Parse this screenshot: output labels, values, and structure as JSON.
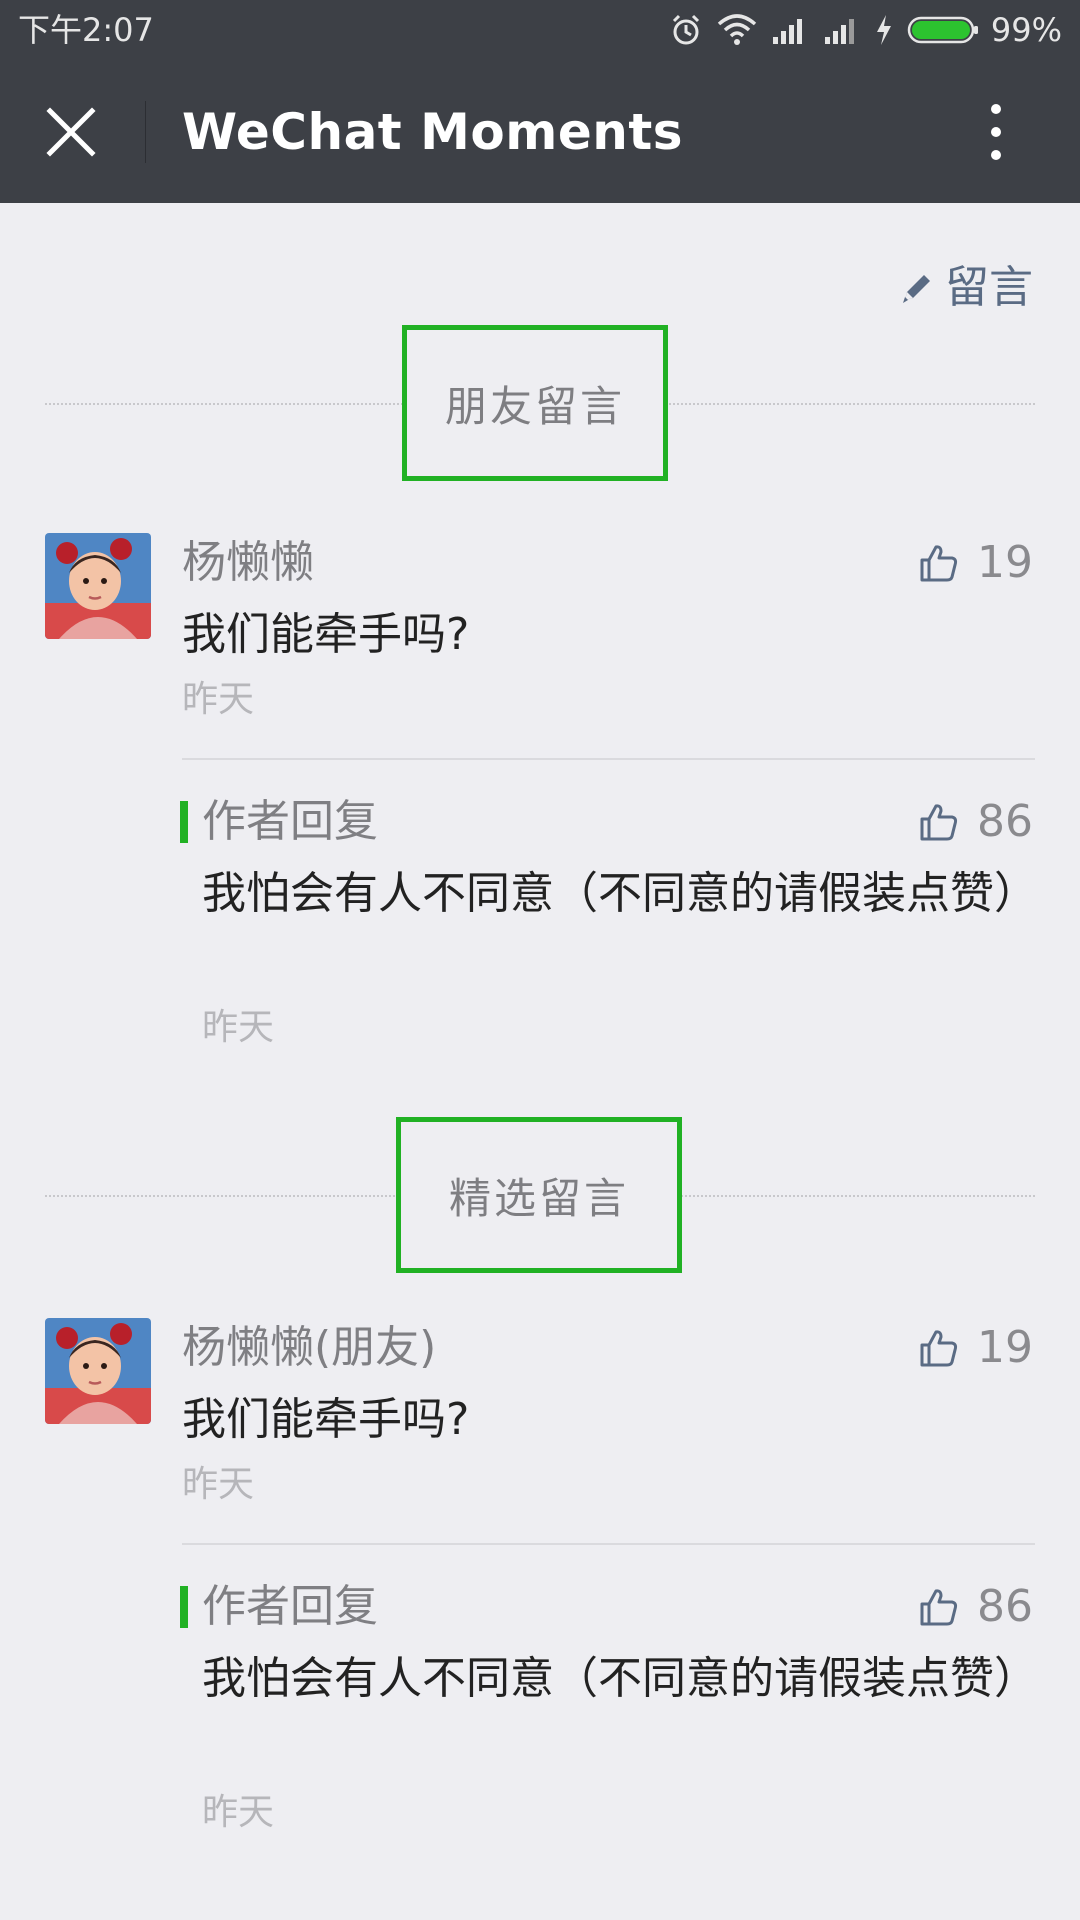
{
  "status_bar": {
    "time": "下午2:07",
    "battery_percent": "99%",
    "icons": [
      "alarm-icon",
      "wifi-icon",
      "signal-icon",
      "signal-icon",
      "charging-icon",
      "battery-icon"
    ],
    "battery_color": "#2cc32f"
  },
  "header": {
    "title": "WeChat Moments",
    "close_icon": "close-icon",
    "more_icon": "more-vertical-icon"
  },
  "write_comment": {
    "label": "留言",
    "icon": "pencil-icon"
  },
  "accent_color": "#21b124",
  "sections": [
    {
      "title": "朋友留言",
      "comments": [
        {
          "name": "杨懒懒",
          "text": "我们能牵手吗?",
          "time": "昨天",
          "likes": "19",
          "reply": {
            "label": "作者回复",
            "text": "我怕会有人不同意（不同意的请假装点赞）",
            "time": "昨天",
            "likes": "86"
          }
        }
      ]
    },
    {
      "title": "精选留言",
      "comments": [
        {
          "name": "杨懒懒(朋友)",
          "text": "我们能牵手吗?",
          "time": "昨天",
          "likes": "19",
          "reply": {
            "label": "作者回复",
            "text": "我怕会有人不同意（不同意的请假装点赞）",
            "time": "昨天",
            "likes": "86"
          }
        }
      ]
    }
  ]
}
